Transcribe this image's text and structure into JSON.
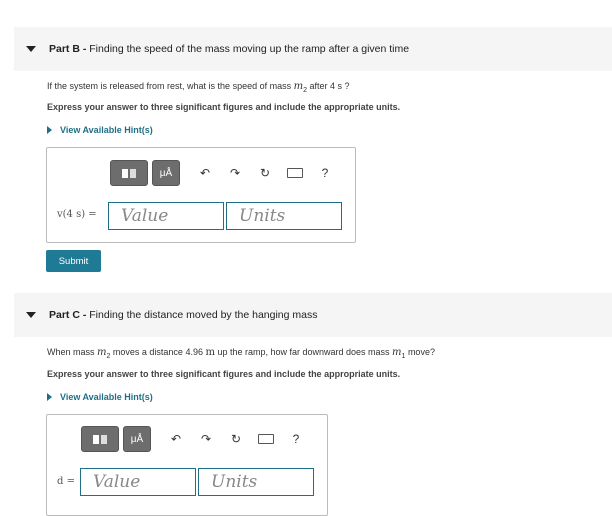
{
  "partB": {
    "label": "Part B -",
    "title": "Finding the speed of the mass moving up the ramp after a given time",
    "question_pre": "If the system is released from rest, what is the speed of mass ",
    "question_var": "m",
    "question_sub": "2",
    "question_post": " after 4 s ?",
    "instruction": "Express your answer to three significant figures and include the appropriate units.",
    "hint": "View Available Hint(s)",
    "answer_label": "v(4 s) =",
    "value_placeholder": "Value",
    "units_placeholder": "Units",
    "submit": "Submit"
  },
  "partC": {
    "label": "Part C -",
    "title": "Finding the distance moved by the hanging mass",
    "question_pre": "When mass ",
    "question_var1": "m",
    "question_sub1": "2",
    "question_mid": " moves a distance 4.96 ",
    "question_unit": "m",
    "question_mid2": " up the ramp, how far downward does mass ",
    "question_var2": "m",
    "question_sub2": "1",
    "question_post": " move?",
    "instruction": "Express your answer to three significant figures and include the appropriate units.",
    "hint": "View Available Hint(s)",
    "answer_label": "d =",
    "value_placeholder": "Value",
    "units_placeholder": "Units"
  },
  "toolbar": {
    "templates_icon": "templates-icon",
    "units_label": "μÅ",
    "undo_icon": "undo-icon",
    "redo_icon": "redo-icon",
    "reset_icon": "reset-icon",
    "keyboard_icon": "keyboard-icon",
    "help_label": "?"
  }
}
